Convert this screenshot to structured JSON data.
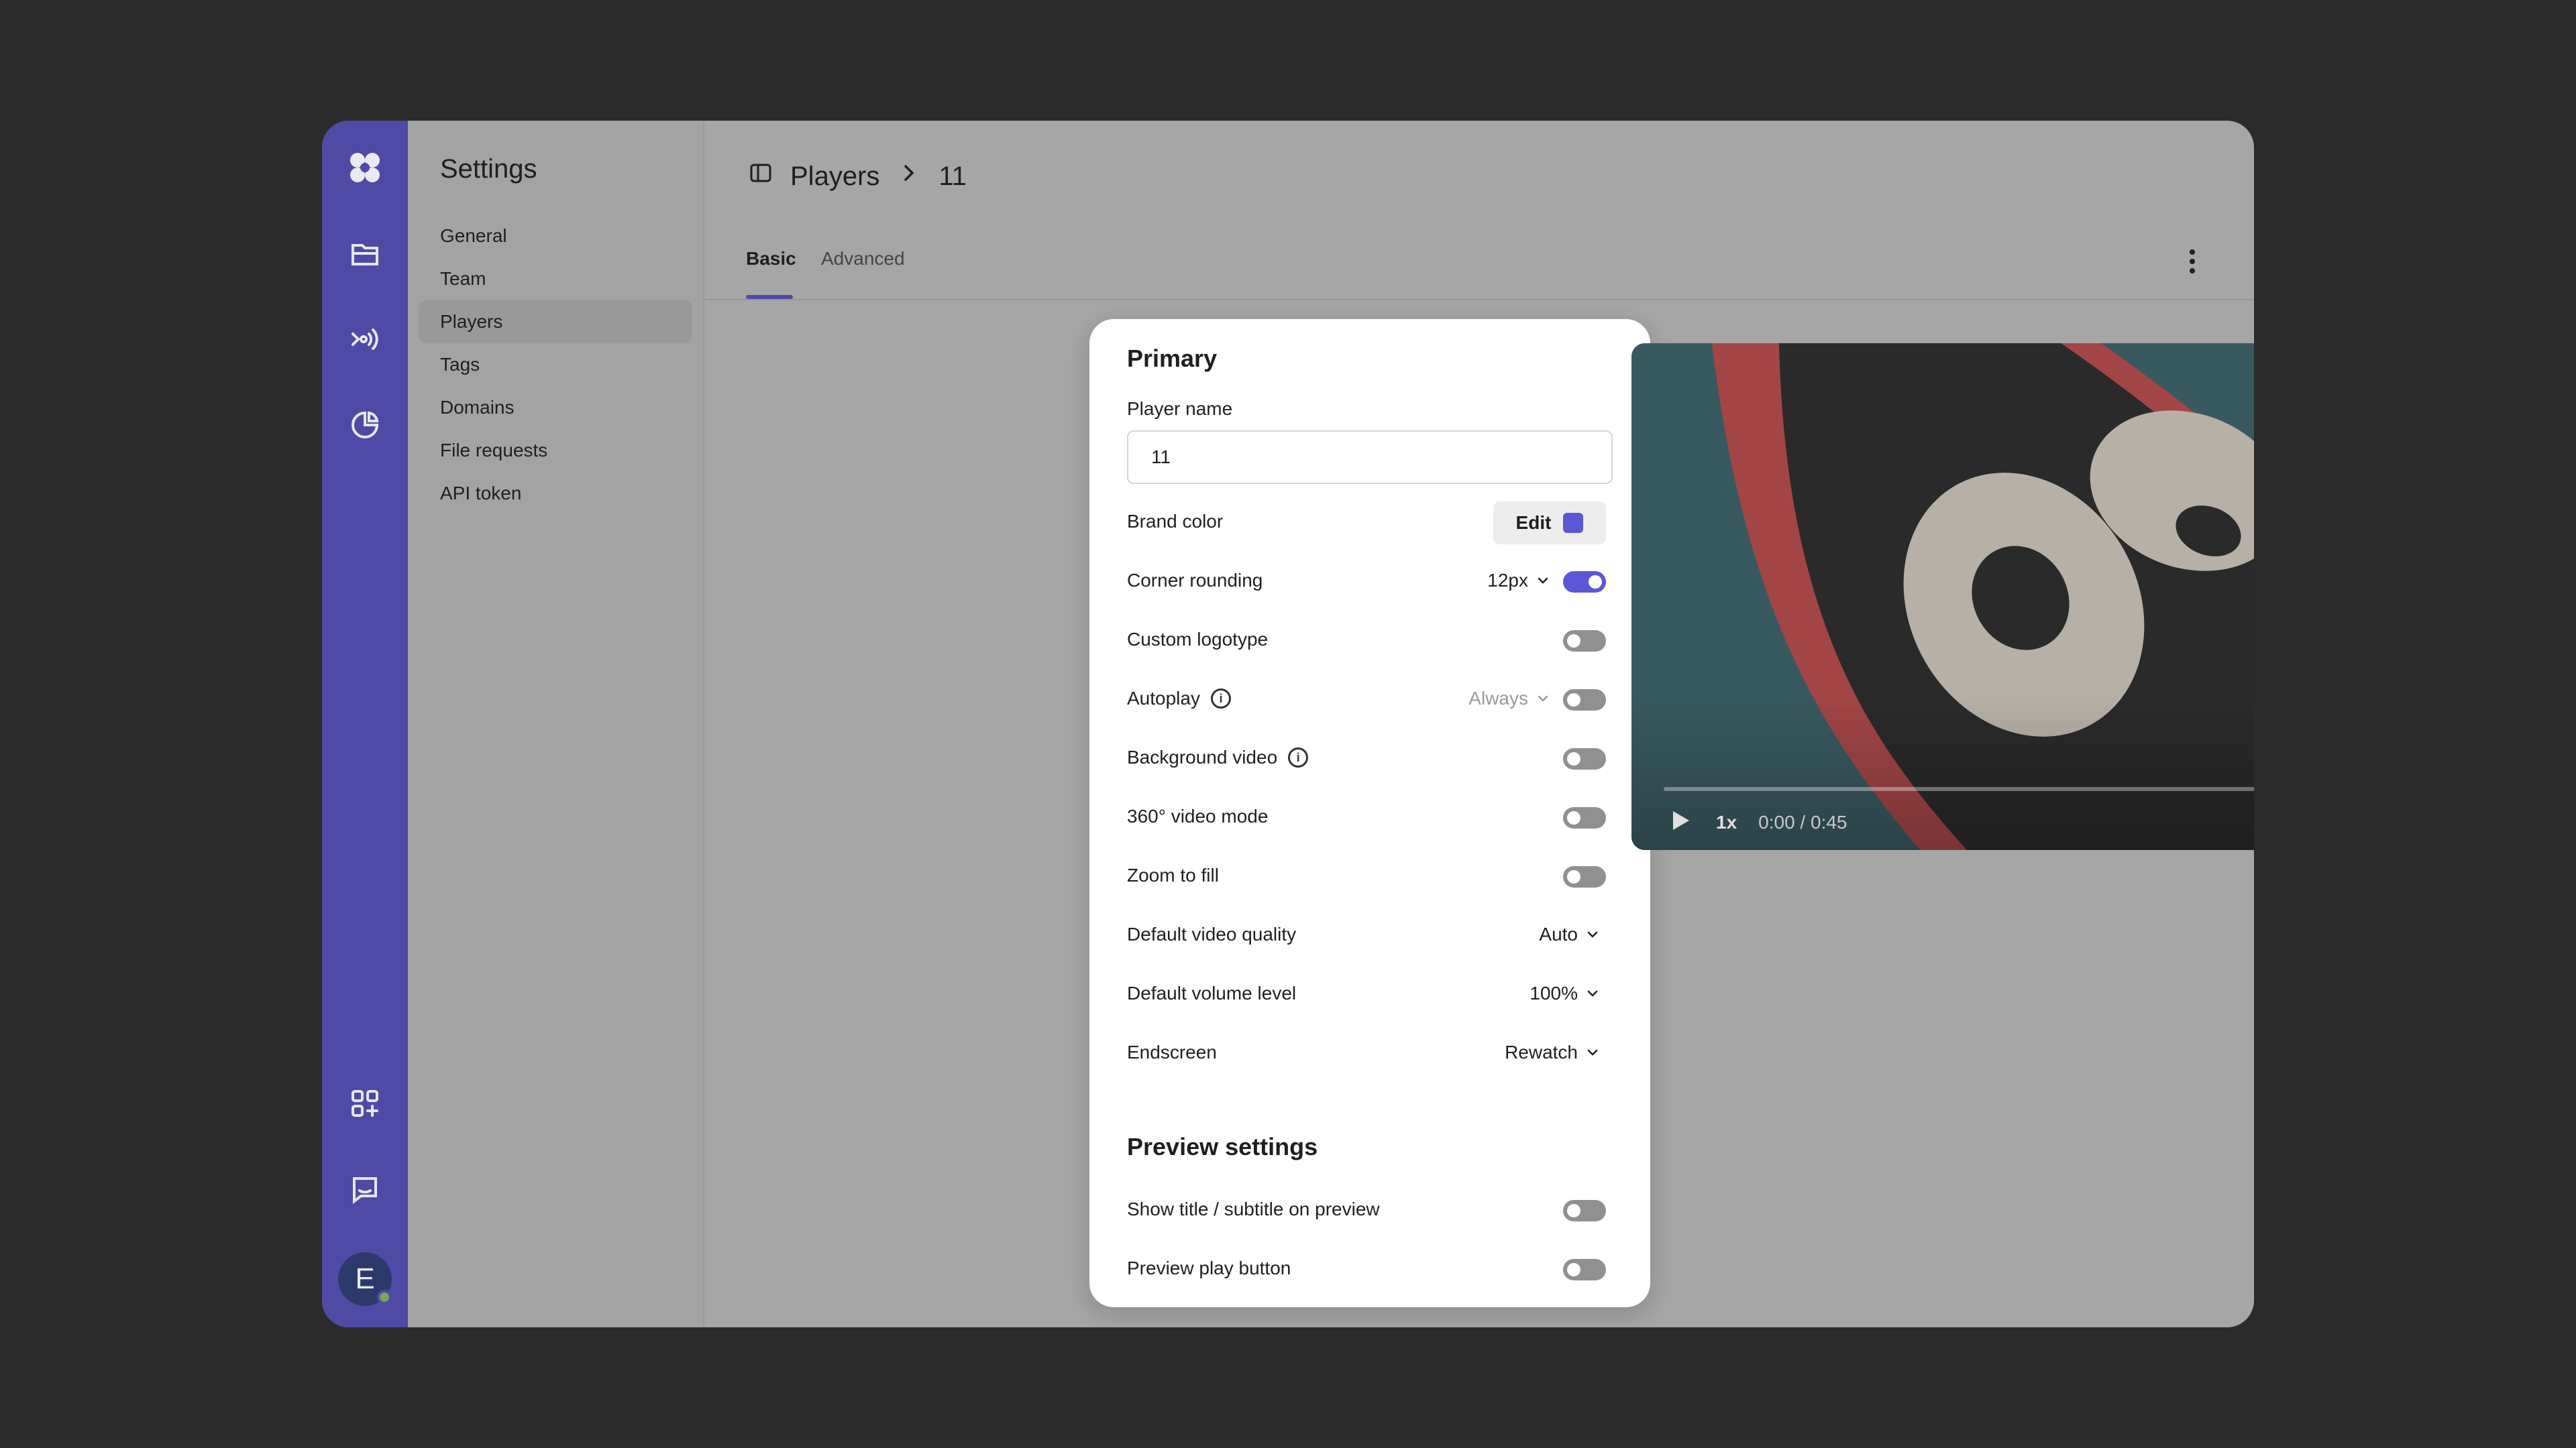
{
  "colors": {
    "accent": "#4f4aa6",
    "toggle_on": "#5b57d6",
    "brand_swatch": "#5b57d6"
  },
  "rail": {
    "icons": [
      "logo-icon",
      "library-icon",
      "broadcast-icon",
      "analytics-icon",
      "apps-icon",
      "chat-icon"
    ],
    "avatar_letter": "E"
  },
  "sidebar": {
    "title": "Settings",
    "items": [
      {
        "label": "General"
      },
      {
        "label": "Team"
      },
      {
        "label": "Players",
        "active": true
      },
      {
        "label": "Tags"
      },
      {
        "label": "Domains"
      },
      {
        "label": "File requests"
      },
      {
        "label": "API token"
      }
    ]
  },
  "header": {
    "breadcrumb_root": "Players",
    "breadcrumb_current": "11",
    "tabs": [
      {
        "label": "Basic",
        "active": true
      },
      {
        "label": "Advanced"
      }
    ]
  },
  "panel": {
    "primary_title": "Primary",
    "player_name_label": "Player name",
    "player_name_value": "11",
    "brand_color_label": "Brand color",
    "edit_label": "Edit",
    "corner_rounding_label": "Corner rounding",
    "corner_rounding_value": "12px",
    "corner_rounding_on": true,
    "custom_logotype_label": "Custom logotype",
    "autoplay_label": "Autoplay",
    "autoplay_value": "Always",
    "background_video_label": "Background video",
    "video_360_label": "360° video mode",
    "zoom_to_fill_label": "Zoom to fill",
    "default_quality_label": "Default video quality",
    "default_quality_value": "Auto",
    "default_volume_label": "Default volume level",
    "default_volume_value": "100%",
    "endscreen_label": "Endscreen",
    "endscreen_value": "Rewatch",
    "preview_title": "Preview settings",
    "show_title_label": "Show title / subtitle on preview",
    "preview_play_label": "Preview play button"
  },
  "video": {
    "speed": "1x",
    "time": "0:00 / 0:45",
    "progress": 0
  }
}
